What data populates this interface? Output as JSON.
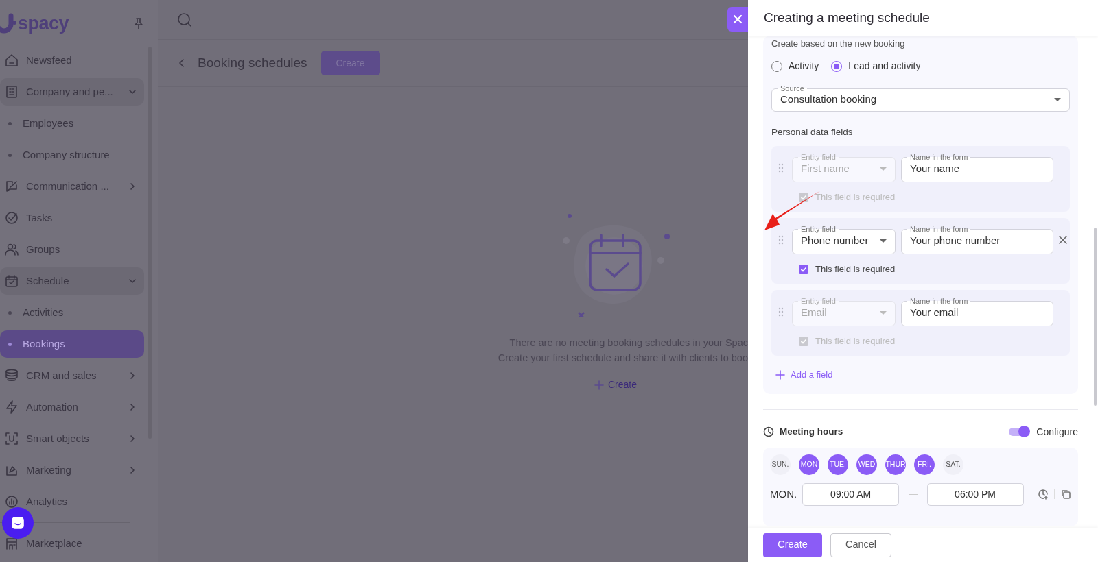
{
  "sidebar": {
    "logo": "spacy",
    "items": [
      {
        "label": "Newsfeed",
        "selected": false
      },
      {
        "label": "Company and pe...",
        "selected": false,
        "expanded": true,
        "children": [
          {
            "label": "Employees",
            "selected": false
          },
          {
            "label": "Company structure",
            "selected": false
          }
        ]
      },
      {
        "label": "Communication ...",
        "selected": false,
        "expanded": false
      },
      {
        "label": "Tasks",
        "selected": false
      },
      {
        "label": "Groups",
        "selected": false
      },
      {
        "label": "Schedule",
        "selected": false,
        "expanded": true,
        "children": [
          {
            "label": "Activities",
            "selected": false
          },
          {
            "label": "Bookings",
            "selected": true
          }
        ]
      },
      {
        "label": "CRM and sales",
        "selected": false,
        "expanded": false
      },
      {
        "label": "Automation",
        "selected": false,
        "expanded": false
      },
      {
        "label": "Smart objects",
        "selected": false,
        "expanded": false
      },
      {
        "label": "Marketing",
        "selected": false,
        "expanded": false
      },
      {
        "label": "Analytics",
        "selected": false
      },
      {
        "label": "Marketplace",
        "selected": false
      }
    ]
  },
  "main": {
    "page_title": "Booking schedules",
    "create_button": "Create",
    "empty_state": {
      "lines": [
        "There are no meeting booking schedules in your Spac",
        "Create your first schedule and share it with clients to boo"
      ],
      "create_link": "Create"
    }
  },
  "drawer": {
    "title": "Creating a meeting schedule",
    "caption": "Create based on the new booking",
    "radios": [
      {
        "label": "Activity",
        "selected": false
      },
      {
        "label": "Lead and activity",
        "selected": true
      }
    ],
    "source": {
      "label": "Source",
      "value": "Consultation booking"
    },
    "fields_title": "Personal data fields",
    "fields": [
      {
        "entity_label": "Entity field",
        "entity_value": "First name",
        "entity_disabled": true,
        "name_label": "Name in the form",
        "name_value": "Your name",
        "required_label": "This field is required",
        "required_checked": true,
        "required_disabled": true,
        "removable": false
      },
      {
        "entity_label": "Entity field",
        "entity_value": "Phone number",
        "entity_disabled": false,
        "name_label": "Name in the form",
        "name_value": "Your phone number",
        "required_label": "This field is required",
        "required_checked": true,
        "required_disabled": false,
        "removable": true
      },
      {
        "entity_label": "Entity field",
        "entity_value": "Email",
        "entity_disabled": true,
        "name_label": "Name in the form",
        "name_value": "Your email",
        "required_label": "This field is required",
        "required_checked": true,
        "required_disabled": true,
        "removable": false
      }
    ],
    "add_field": "Add a field",
    "meeting_hours": {
      "title": "Meeting hours",
      "configure": {
        "label": "Configure",
        "on": true
      },
      "days": [
        {
          "label": "SUN.",
          "selected": false
        },
        {
          "label": "MON",
          "selected": true
        },
        {
          "label": "TUE.",
          "selected": true
        },
        {
          "label": "WED",
          "selected": true
        },
        {
          "label": "THUR",
          "selected": true
        },
        {
          "label": "FRI.",
          "selected": true
        },
        {
          "label": "SAT.",
          "selected": false
        }
      ],
      "rows": [
        {
          "day": "MON.",
          "from": "09:00 AM",
          "to": "06:00 PM"
        }
      ]
    },
    "buttons": [
      {
        "label": "Create",
        "kind": "primary"
      },
      {
        "label": "Cancel",
        "kind": "secondary"
      }
    ]
  }
}
